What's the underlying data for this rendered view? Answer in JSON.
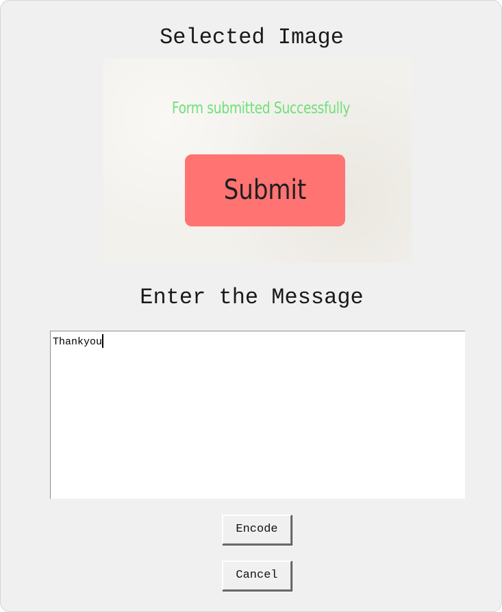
{
  "window": {
    "selected_image_title": "Selected Image",
    "message_title": "Enter the Message"
  },
  "preview": {
    "success_text": "Form submitted Successfully",
    "button_label": "Submit",
    "colors": {
      "success": "#6fe07a",
      "button": "#ff7373"
    }
  },
  "message": {
    "value": "Thankyou"
  },
  "buttons": {
    "encode_label": "Encode",
    "cancel_label": "Cancel"
  }
}
